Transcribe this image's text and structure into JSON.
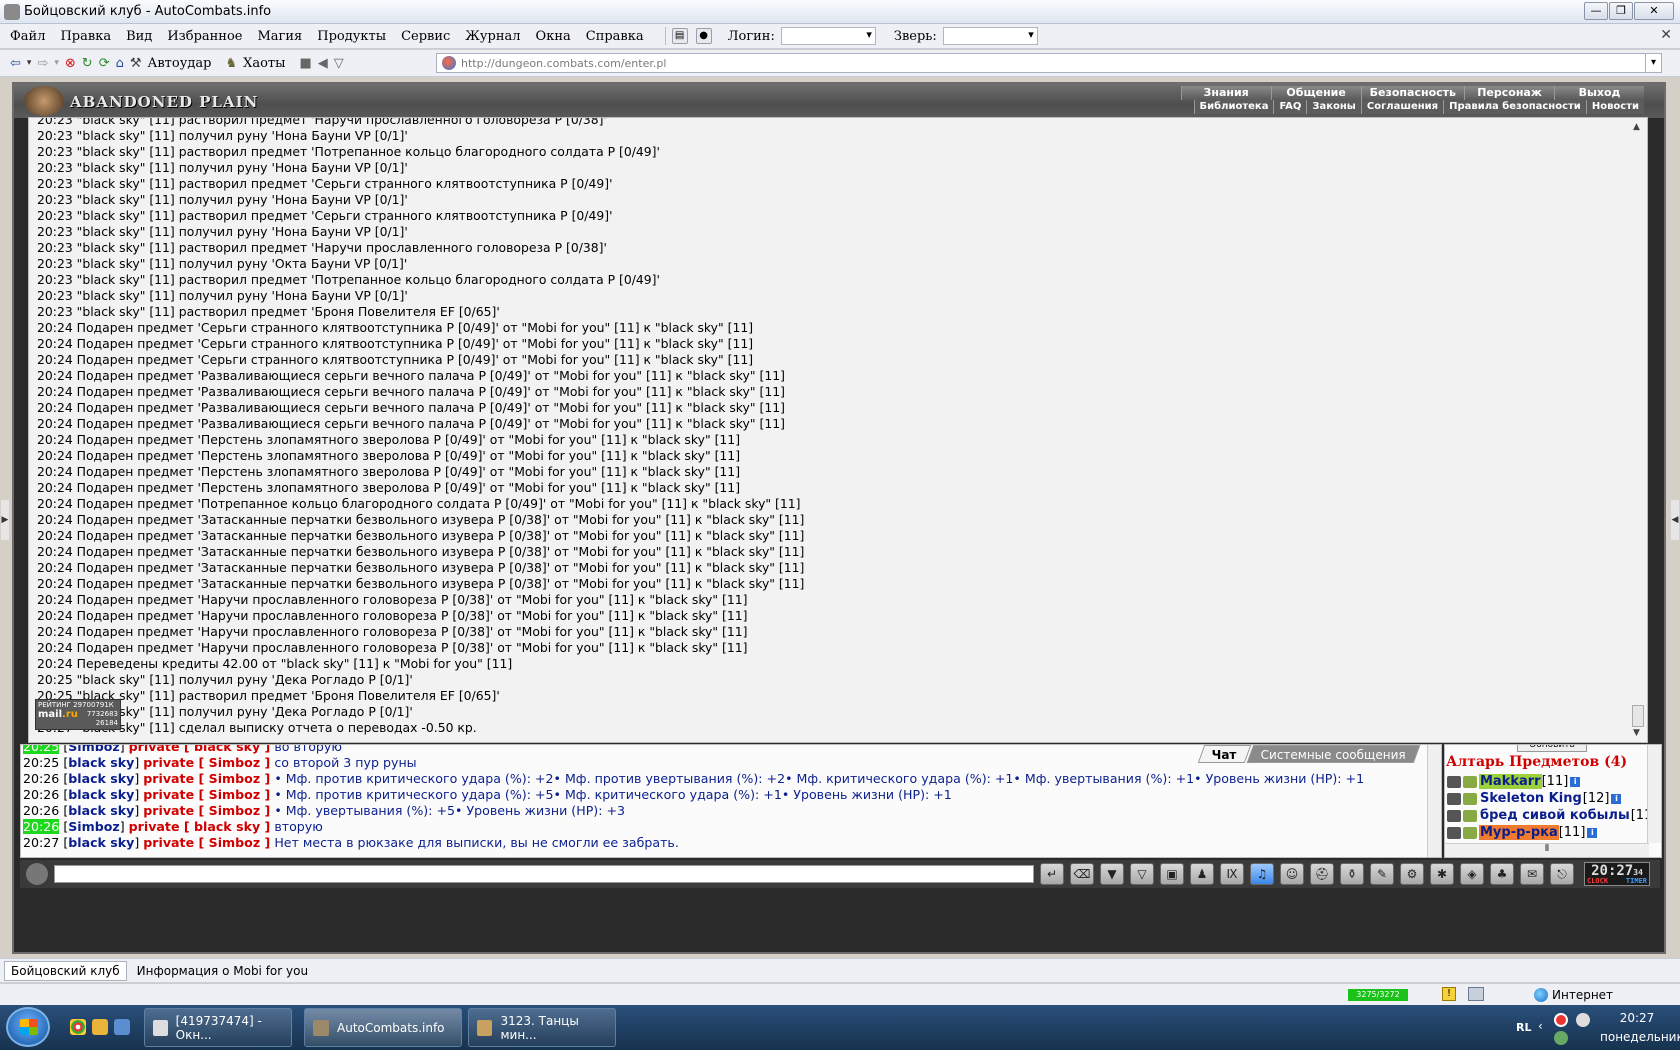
{
  "window": {
    "title": "Бойцовский клуб - AutoCombats.info"
  },
  "menu": {
    "items": [
      "Файл",
      "Правка",
      "Вид",
      "Избранное",
      "Магия",
      "Продукты",
      "Сервис",
      "Журнал",
      "Окна",
      "Справка"
    ],
    "login_label": "Логин:",
    "beast_label": "Зверь:"
  },
  "toolbar": {
    "autoudar": "Автоудар",
    "chaos": "Хаоты",
    "url": "http://dungeon.combats.com/enter.pl"
  },
  "game": {
    "logo": "ABANDONED PLAIN",
    "nav_top": [
      "Знания",
      "Общение",
      "Безопасность",
      "Персонаж",
      "Выход"
    ],
    "nav_bottom": [
      "Библиотека",
      "FAQ",
      "Законы",
      "Соглашения",
      "Правила безопасности",
      "Новости"
    ]
  },
  "log": [
    "20:23 \"black sky\" [11] растворил предмет 'Наручи прославленного головореза P [0/38]'",
    "20:23 \"black sky\" [11] получил руну 'Нона Бауни VP [0/1]'",
    "20:23 \"black sky\" [11] растворил предмет 'Потрепанное кольцо благородного солдата P [0/49]'",
    "20:23 \"black sky\" [11] получил руну 'Нона Бауни VP [0/1]'",
    "20:23 \"black sky\" [11] растворил предмет 'Серьги странного клятвоотступника P [0/49]'",
    "20:23 \"black sky\" [11] получил руну 'Нона Бауни VP [0/1]'",
    "20:23 \"black sky\" [11] растворил предмет 'Серьги странного клятвоотступника P [0/49]'",
    "20:23 \"black sky\" [11] получил руну 'Нона Бауни VP [0/1]'",
    "20:23 \"black sky\" [11] растворил предмет 'Наручи прославленного головореза P [0/38]'",
    "20:23 \"black sky\" [11] получил руну 'Окта Бауни VP [0/1]'",
    "20:23 \"black sky\" [11] растворил предмет 'Потрепанное кольцо благородного солдата P [0/49]'",
    "20:23 \"black sky\" [11] получил руну 'Нона Бауни VP [0/1]'",
    "20:23 \"black sky\" [11] растворил предмет 'Броня Повелителя EF [0/65]'",
    "20:24 Подарен предмет 'Серьги странного клятвоотступника P [0/49]' от \"Mobi for you\" [11] к \"black sky\" [11]",
    "20:24 Подарен предмет 'Серьги странного клятвоотступника P [0/49]' от \"Mobi for you\" [11] к \"black sky\" [11]",
    "20:24 Подарен предмет 'Серьги странного клятвоотступника P [0/49]' от \"Mobi for you\" [11] к \"black sky\" [11]",
    "20:24 Подарен предмет 'Разваливающиеся серьги вечного палача P [0/49]' от \"Mobi for you\" [11] к \"black sky\" [11]",
    "20:24 Подарен предмет 'Разваливающиеся серьги вечного палача P [0/49]' от \"Mobi for you\" [11] к \"black sky\" [11]",
    "20:24 Подарен предмет 'Разваливающиеся серьги вечного палача P [0/49]' от \"Mobi for you\" [11] к \"black sky\" [11]",
    "20:24 Подарен предмет 'Разваливающиеся серьги вечного палача P [0/49]' от \"Mobi for you\" [11] к \"black sky\" [11]",
    "20:24 Подарен предмет 'Перстень злопамятного зверолова P [0/49]' от \"Mobi for you\" [11] к \"black sky\" [11]",
    "20:24 Подарен предмет 'Перстень злопамятного зверолова P [0/49]' от \"Mobi for you\" [11] к \"black sky\" [11]",
    "20:24 Подарен предмет 'Перстень злопамятного зверолова P [0/49]' от \"Mobi for you\" [11] к \"black sky\" [11]",
    "20:24 Подарен предмет 'Перстень злопамятного зверолова P [0/49]' от \"Mobi for you\" [11] к \"black sky\" [11]",
    "20:24 Подарен предмет 'Потрепанное кольцо благородного солдата P [0/49]' от \"Mobi for you\" [11] к \"black sky\" [11]",
    "20:24 Подарен предмет 'Затасканные перчатки безвольного изувера P [0/38]' от \"Mobi for you\" [11] к \"black sky\" [11]",
    "20:24 Подарен предмет 'Затасканные перчатки безвольного изувера P [0/38]' от \"Mobi for you\" [11] к \"black sky\" [11]",
    "20:24 Подарен предмет 'Затасканные перчатки безвольного изувера P [0/38]' от \"Mobi for you\" [11] к \"black sky\" [11]",
    "20:24 Подарен предмет 'Затасканные перчатки безвольного изувера P [0/38]' от \"Mobi for you\" [11] к \"black sky\" [11]",
    "20:24 Подарен предмет 'Затасканные перчатки безвольного изувера P [0/38]' от \"Mobi for you\" [11] к \"black sky\" [11]",
    "20:24 Подарен предмет 'Наручи прославленного головореза P [0/38]' от \"Mobi for you\" [11] к \"black sky\" [11]",
    "20:24 Подарен предмет 'Наручи прославленного головореза P [0/38]' от \"Mobi for you\" [11] к \"black sky\" [11]",
    "20:24 Подарен предмет 'Наручи прославленного головореза P [0/38]' от \"Mobi for you\" [11] к \"black sky\" [11]",
    "20:24 Подарен предмет 'Наручи прославленного головореза P [0/38]' от \"Mobi for you\" [11] к \"black sky\" [11]",
    "20:24 Переведены кредиты 42.00 от \"black sky\" [11] к \"Mobi for you\" [11]",
    "20:25 \"black sky\" [11] получил руну 'Дека Рогладо P [0/1]'",
    "20:25 \"black sky\" [11] растворил предмет 'Броня Повелителя EF [0/65]'",
    "20:26 \"black sky\" [11] получил руну 'Дека Рогладо P [0/1]'",
    "20:27 \"black sky\" [11] сделал выписку отчета о переводах -0.50 кр."
  ],
  "rating_badge": {
    "line1": "РЕЙТИНГ 29700791К",
    "line2": "7732683",
    "line3": "26184",
    "mail": "mail",
    "ru": ".ru"
  },
  "chat": {
    "tabs": [
      "Чат",
      "Системные сообщения"
    ],
    "lines": [
      {
        "time": "20:25",
        "hl": true,
        "from": "Simboz",
        "to": "black sky",
        "text": "во вторую"
      },
      {
        "time": "20:25",
        "hl": false,
        "from": "black sky",
        "to": "Simboz",
        "text": "со второй 3 пур руны"
      },
      {
        "time": "20:26",
        "hl": false,
        "from": "black sky",
        "to": "Simboz",
        "text": "• Мф. против критического удара (%): +2• Мф. против увертывания (%): +2• Мф. критического удара (%): +1• Мф. увертывания (%): +1• Уровень жизни (HP): +1"
      },
      {
        "time": "20:26",
        "hl": false,
        "from": "black sky",
        "to": "Simboz",
        "text": "• Мф. против критического удара (%): +5• Мф. критического удара (%): +1• Уровень жизни (HP): +1"
      },
      {
        "time": "20:26",
        "hl": false,
        "from": "black sky",
        "to": "Simboz",
        "text": "• Мф. увертывания (%): +5• Уровень жизни (HP): +3"
      },
      {
        "time": "20:26",
        "hl": true,
        "from": "Simboz",
        "to": "black sky",
        "text": "вторую"
      },
      {
        "time": "20:27",
        "hl": false,
        "from": "black sky",
        "to": "Simboz",
        "text": "Нет места в рюкзаке для выписки, вы не смогли ее забрать."
      }
    ],
    "private_word": "private"
  },
  "side_panel": {
    "refresh": "Обновить",
    "title": "Алтарь Предметов (4)",
    "users": [
      {
        "name": "Makkarr",
        "level": "[11]",
        "style": "yellow"
      },
      {
        "name": "Skeleton King",
        "level": "[12]",
        "style": "plain"
      },
      {
        "name": "бред сивой кобылы",
        "level": "[11",
        "style": "plain"
      },
      {
        "name": "Мур-р-рка",
        "level": "[11]",
        "style": "orange"
      }
    ]
  },
  "game_clock": {
    "time": "20:27",
    "seconds": "34",
    "clock_label": "CLOCK",
    "timer_label": "TIMER"
  },
  "browser_tabs": [
    "Бойцовский клуб",
    "Информация о Mobi for you"
  ],
  "status": {
    "counter": "3275/3272",
    "zone": "Интернет"
  },
  "taskbar": {
    "tasks": [
      "[419737474] - Окн...",
      "AutoCombats.info",
      "3123. Танцы мин..."
    ],
    "lang": "RL",
    "time": "20:27",
    "day": "понедельник"
  }
}
